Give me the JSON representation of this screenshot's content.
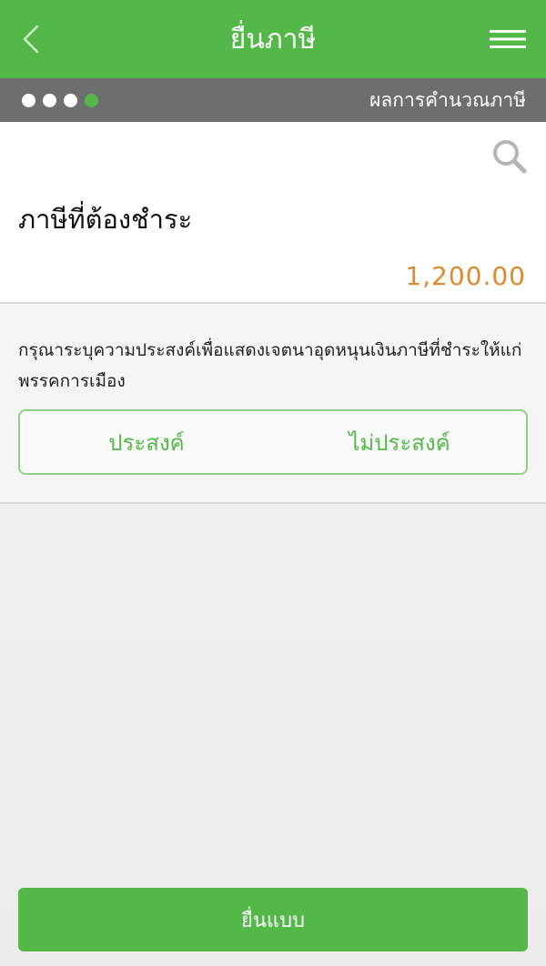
{
  "header": {
    "title": "ยื่นภาษี",
    "back_icon": "chevron-left-icon",
    "menu_icon": "hamburger-menu-icon"
  },
  "stepbar": {
    "total_steps": 4,
    "current_step": 4,
    "label": "ผลการคำนวณภาษี"
  },
  "summary": {
    "search_icon": "search-icon",
    "title": "ภาษีที่ต้องชำระ",
    "amount": "1,200.00"
  },
  "question": {
    "text": "กรุณาระบุความประสงค์เพื่อแสดงเจตนาอุดหนุนเงินภาษีที่ชำระให้แก่พรรคการเมือง",
    "options": [
      "ประสงค์",
      "ไม่ประสงค์"
    ]
  },
  "submit": {
    "label": "ยื่นแบบ"
  },
  "colors": {
    "brand_green": "#54b848",
    "step_bar_gray": "#6d6e70",
    "amount_orange": "#e08a2f"
  }
}
